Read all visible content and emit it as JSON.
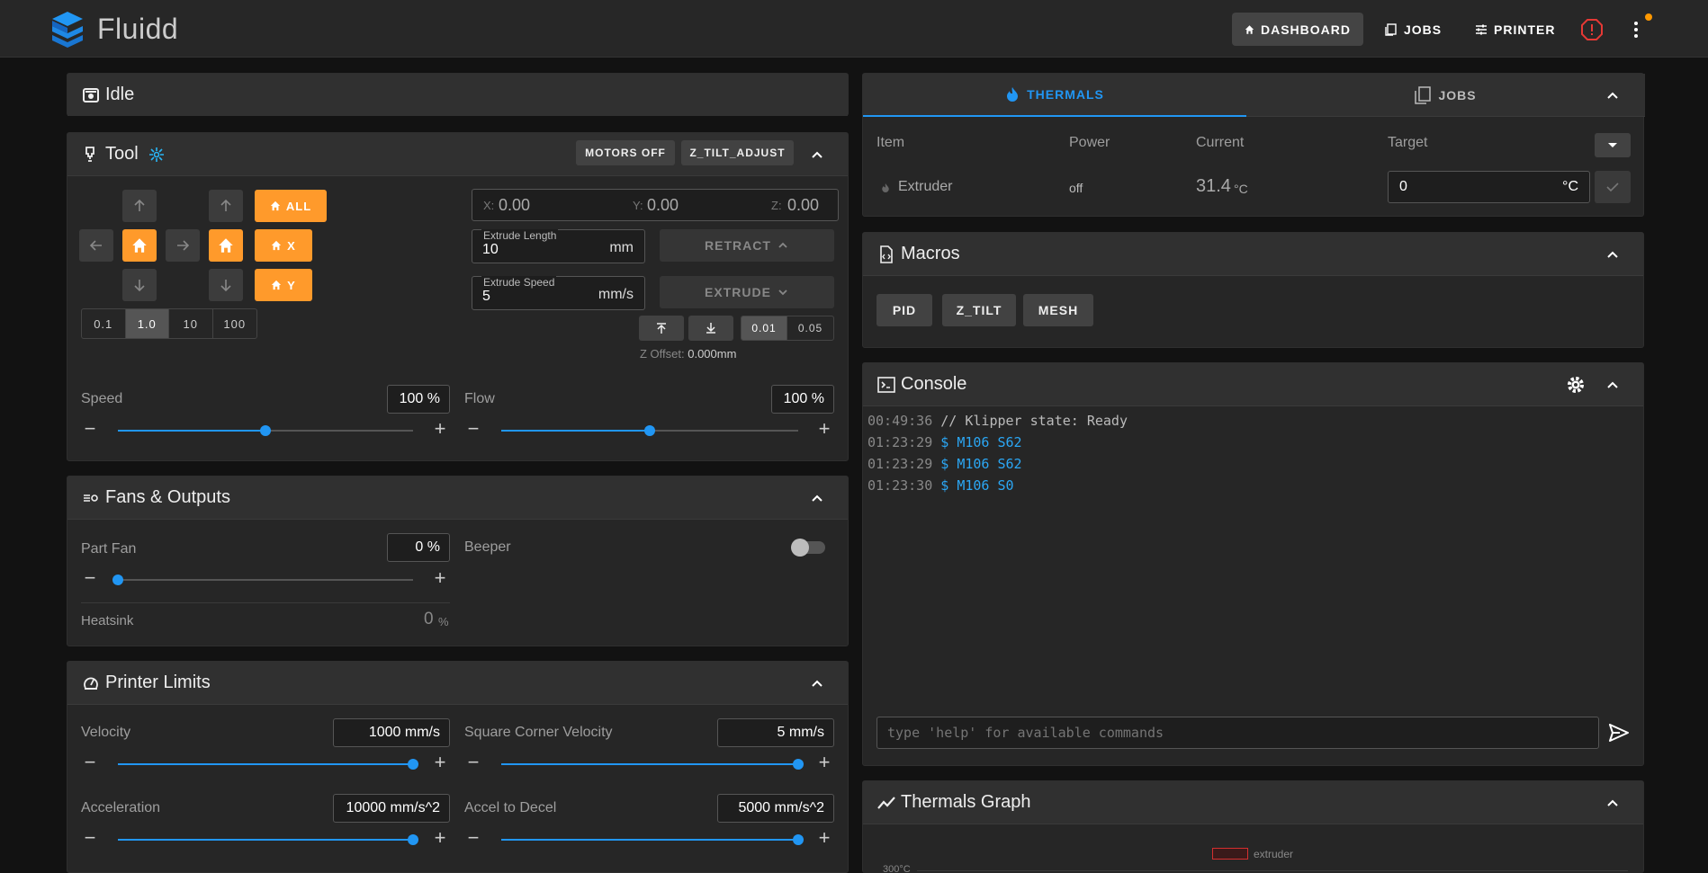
{
  "app": {
    "name": "Fluidd"
  },
  "nav": {
    "dashboard": "DASHBOARD",
    "jobs": "JOBS",
    "printer": "PRINTER"
  },
  "status": {
    "title": "Idle"
  },
  "tool": {
    "title": "Tool",
    "motors_off": "MOTORS OFF",
    "z_tilt_adjust": "Z_TILT_ADJUST",
    "home_all": "ALL",
    "home_x": "X",
    "home_y": "Y",
    "steps": [
      "0.1",
      "1.0",
      "10",
      "100"
    ],
    "selected_step": "1.0",
    "pos_x_label": "X:",
    "pos_x": "0.00",
    "pos_y_label": "Y:",
    "pos_y": "0.00",
    "pos_z_label": "Z:",
    "pos_z": "0.00",
    "extrude_length_label": "Extrude Length",
    "extrude_length": "10",
    "extrude_length_unit": "mm",
    "extrude_speed_label": "Extrude Speed",
    "extrude_speed": "5",
    "extrude_speed_unit": "mm/s",
    "retract": "RETRACT",
    "extrude": "EXTRUDE",
    "z_steps": [
      "0.01",
      "0.05"
    ],
    "z_offset_label": "Z Offset:",
    "z_offset": "0.000mm",
    "speed_label": "Speed",
    "speed_value": "100 %",
    "speed_fraction": 0.5,
    "flow_label": "Flow",
    "flow_value": "100 %",
    "flow_fraction": 0.5
  },
  "fans": {
    "title": "Fans & Outputs",
    "part_fan_label": "Part Fan",
    "part_fan_value": "0 %",
    "part_fan_fraction": 0,
    "beeper_label": "Beeper",
    "beeper_on": false,
    "heatsink_label": "Heatsink",
    "heatsink_value": "0",
    "heatsink_unit": "%"
  },
  "limits": {
    "title": "Printer Limits",
    "velocity_label": "Velocity",
    "velocity_value": "1000 mm/s",
    "scv_label": "Square Corner Velocity",
    "scv_value": "5 mm/s",
    "accel_label": "Acceleration",
    "accel_value": "10000 mm/s^2",
    "accel_decel_label": "Accel to Decel",
    "accel_decel_value": "5000 mm/s^2"
  },
  "thermals": {
    "tab_thermals": "THERMALS",
    "tab_jobs": "JOBS",
    "col_item": "Item",
    "col_power": "Power",
    "col_current": "Current",
    "col_target": "Target",
    "row_name": "Extruder",
    "row_power": "off",
    "row_current": "31.4",
    "row_current_unit": "°C",
    "row_target": "0",
    "row_target_unit": "°C"
  },
  "macros": {
    "title": "Macros",
    "buttons": [
      "PID",
      "Z_TILT",
      "MESH"
    ]
  },
  "console": {
    "title": "Console",
    "lines": [
      {
        "time": "00:49:36",
        "text": "// Klipper state: Ready"
      },
      {
        "time": "01:23:29",
        "text": "$ M106 S62"
      },
      {
        "time": "01:23:29",
        "text": "$ M106 S62"
      },
      {
        "time": "01:23:30",
        "text": "$ M106 S0"
      }
    ],
    "input_placeholder": "type 'help' for available commands"
  },
  "graph": {
    "title": "Thermals Graph",
    "legend": "extruder",
    "y_label": "300°C"
  },
  "colors": {
    "accent": "#2196f3",
    "orange": "#ff9a2b",
    "red": "#e53935"
  }
}
